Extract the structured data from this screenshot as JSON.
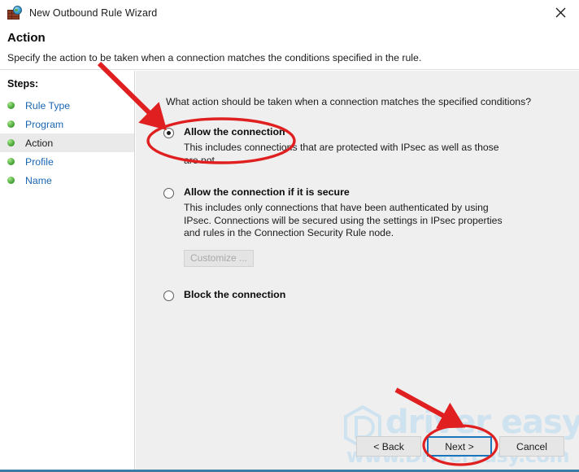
{
  "window": {
    "title": "New Outbound Rule Wizard",
    "icon": "firewall-globe-icon",
    "close_label": "×"
  },
  "header": {
    "title": "Action",
    "subtitle": "Specify the action to be taken when a connection matches the conditions specified in the rule."
  },
  "sidebar": {
    "label": "Steps:",
    "items": [
      {
        "label": "Rule Type",
        "current": false
      },
      {
        "label": "Program",
        "current": false
      },
      {
        "label": "Action",
        "current": true
      },
      {
        "label": "Profile",
        "current": false
      },
      {
        "label": "Name",
        "current": false
      }
    ]
  },
  "main": {
    "prompt": "What action should be taken when a connection matches the specified conditions?",
    "options": [
      {
        "title": "Allow the connection",
        "description": "This includes connections that are protected with IPsec as well as those are not.",
        "selected": true
      },
      {
        "title": "Allow the connection if it is secure",
        "description": "This includes only connections that have been authenticated by using IPsec.  Connections will be secured using the settings in IPsec properties and rules in the Connection Security Rule node.",
        "selected": false,
        "button": {
          "label": "Customize ...",
          "disabled": true
        }
      },
      {
        "title": "Block the connection",
        "description": "",
        "selected": false
      }
    ]
  },
  "footer": {
    "back_label": "< Back",
    "next_label": "Next >",
    "cancel_label": "Cancel"
  },
  "watermark": {
    "brand": "driver easy",
    "url": "www.DriverEasy.com"
  },
  "annotations": {
    "ellipse_allow": "red-ellipse-allow-the-connection",
    "ellipse_next": "red-ellipse-next-button",
    "arrow_top": "red-arrow-to-allow-option",
    "arrow_bottom": "red-arrow-to-next-button",
    "color": "#e02020"
  },
  "colors": {
    "accent_blue": "#1b75bb",
    "bottom_rule": "#3a7ca5",
    "main_bg": "#efefef",
    "link": "#1a66b3",
    "annotation_red": "#e02020"
  }
}
